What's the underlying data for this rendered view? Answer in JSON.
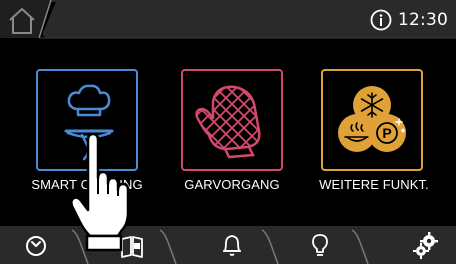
{
  "status_bar": {
    "home_icon": "home-icon",
    "info_icon": "info-icon",
    "time": "12:30"
  },
  "tiles": [
    {
      "label": "SMART COOKING",
      "icon": "chef-serving-icon",
      "color": "#4a8bd6",
      "selected": true
    },
    {
      "label": "GARVORGANG",
      "icon": "oven-mitt-icon",
      "color": "#d4496b",
      "selected": false
    },
    {
      "label": "WEITERE FUNKT.",
      "icon": "special-functions-icon",
      "color": "#e0a236",
      "selected": false
    }
  ],
  "bottom_nav": {
    "items": [
      "timer-icon",
      "recipe-book-icon",
      "alarm-bell-icon",
      "light-bulb-icon",
      "settings-gears-icon"
    ]
  },
  "overlay": {
    "cursor": "hand-pointer-icon"
  }
}
